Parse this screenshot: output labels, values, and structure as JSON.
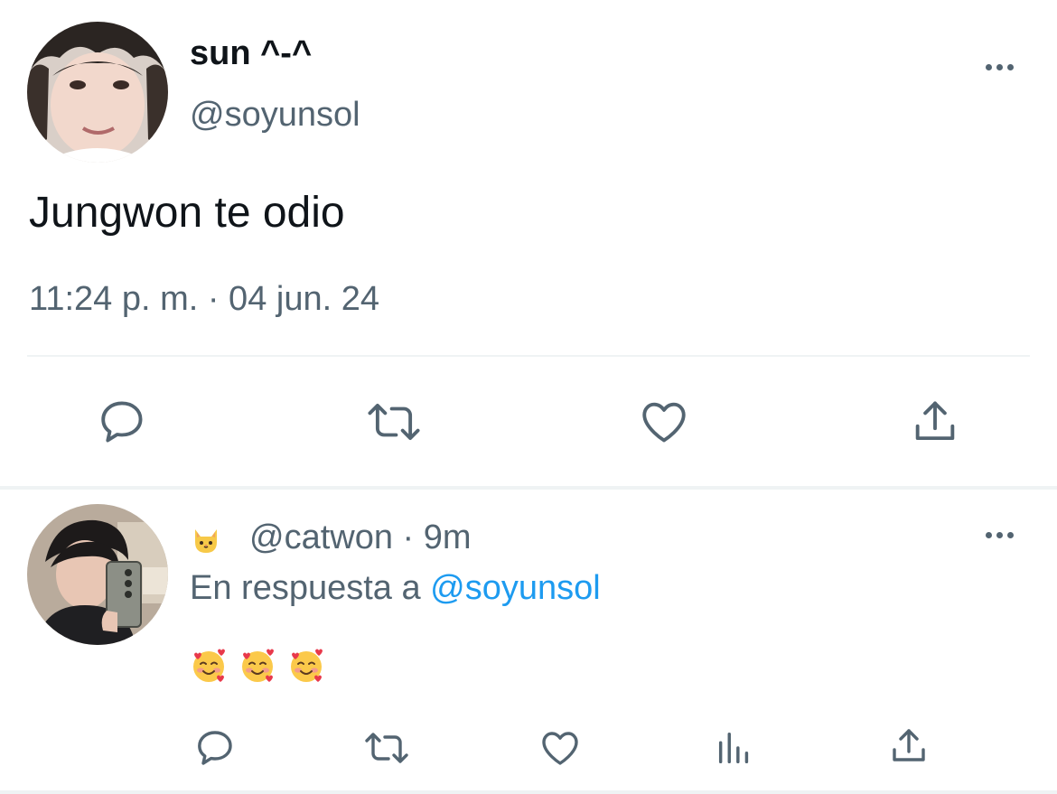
{
  "main_tweet": {
    "display_name": "sun ^-^",
    "handle": "@soyunsol",
    "text": "Jungwon te odio",
    "timestamp": "11:24 p. m. · 04 jun. 24",
    "actions": [
      "reply-icon",
      "retweet-icon",
      "like-icon",
      "share-icon"
    ]
  },
  "reply": {
    "name_emoji": "cat-face-icon",
    "handle": "@catwon",
    "separator": " · ",
    "time": "9m",
    "reply_prefix": "En respuesta a ",
    "reply_mention": "@soyunsol",
    "content_emojis": [
      "smiling-face-with-hearts-icon",
      "smiling-face-with-hearts-icon",
      "smiling-face-with-hearts-icon"
    ],
    "actions": [
      "reply-icon",
      "retweet-icon",
      "like-icon",
      "views-icon",
      "share-icon"
    ]
  },
  "colors": {
    "text_primary": "#0f1419",
    "text_secondary": "#536471",
    "accent": "#1d9bf0",
    "divider": "#eff3f4"
  }
}
